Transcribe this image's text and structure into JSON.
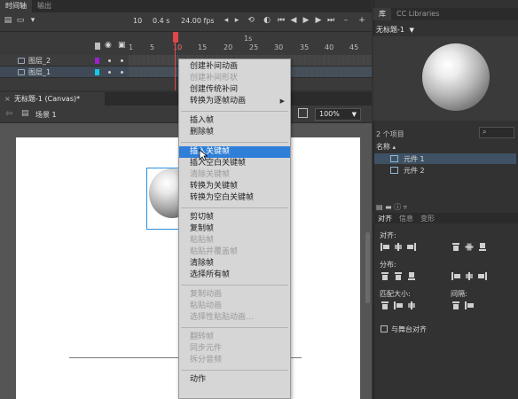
{
  "timeline": {
    "tabs": [
      "时间轴",
      "输出"
    ],
    "frame_current": "10",
    "time": "0.4 s",
    "fps": "24.00 fps",
    "ruler": [
      "1",
      "5",
      "10",
      "15",
      "20",
      "25",
      "30",
      "35",
      "40",
      "45"
    ],
    "seconds_marker": "1s",
    "layers": [
      {
        "name": "图层_2",
        "color": "#a020d0"
      },
      {
        "name": "图层_1",
        "color": "#18c8e8"
      }
    ]
  },
  "document": {
    "tab_title": "无标题-1 (Canvas)*",
    "scene": "场景 1",
    "zoom": "100%"
  },
  "library": {
    "tabs": [
      "库",
      "CC Libraries"
    ],
    "doc_name": "无标题-1",
    "count": "2 个项目",
    "name_column": "名称",
    "items": [
      {
        "name": "元件 1",
        "selected": true
      },
      {
        "name": "元件 2",
        "selected": false
      }
    ]
  },
  "align_panel": {
    "tabs": [
      "对齐",
      "信息",
      "变形"
    ],
    "align_label": "对齐:",
    "distribute_label": "分布:",
    "match_size_label": "匹配大小:",
    "spacing_label": "间隔:",
    "stage_checkbox": "与舞台对齐"
  },
  "context_menu": {
    "groups": [
      [
        {
          "label": "创建补间动画",
          "enabled": true
        },
        {
          "label": "创建补间形状",
          "enabled": false
        },
        {
          "label": "创建传统补间",
          "enabled": true
        },
        {
          "label": "转换为逐帧动画",
          "enabled": true,
          "submenu": true
        }
      ],
      [
        {
          "label": "插入帧",
          "enabled": true
        },
        {
          "label": "删除帧",
          "enabled": true
        }
      ],
      [
        {
          "label": "插入关键帧",
          "enabled": true,
          "highlighted": true
        },
        {
          "label": "插入空白关键帧",
          "enabled": true
        },
        {
          "label": "清除关键帧",
          "enabled": false
        },
        {
          "label": "转换为关键帧",
          "enabled": true
        },
        {
          "label": "转换为空白关键帧",
          "enabled": true
        }
      ],
      [
        {
          "label": "剪切帧",
          "enabled": true
        },
        {
          "label": "复制帧",
          "enabled": true
        },
        {
          "label": "粘贴帧",
          "enabled": false
        },
        {
          "label": "粘贴并覆盖帧",
          "enabled": false
        },
        {
          "label": "清除帧",
          "enabled": true
        },
        {
          "label": "选择所有帧",
          "enabled": true
        }
      ],
      [
        {
          "label": "复制动画",
          "enabled": false
        },
        {
          "label": "粘贴动画",
          "enabled": false
        },
        {
          "label": "选择性粘贴动画...",
          "enabled": false
        }
      ],
      [
        {
          "label": "翻转帧",
          "enabled": false
        },
        {
          "label": "同步元件",
          "enabled": false
        },
        {
          "label": "拆分音频",
          "enabled": false
        }
      ],
      [
        {
          "label": "动作",
          "enabled": true
        }
      ]
    ]
  }
}
